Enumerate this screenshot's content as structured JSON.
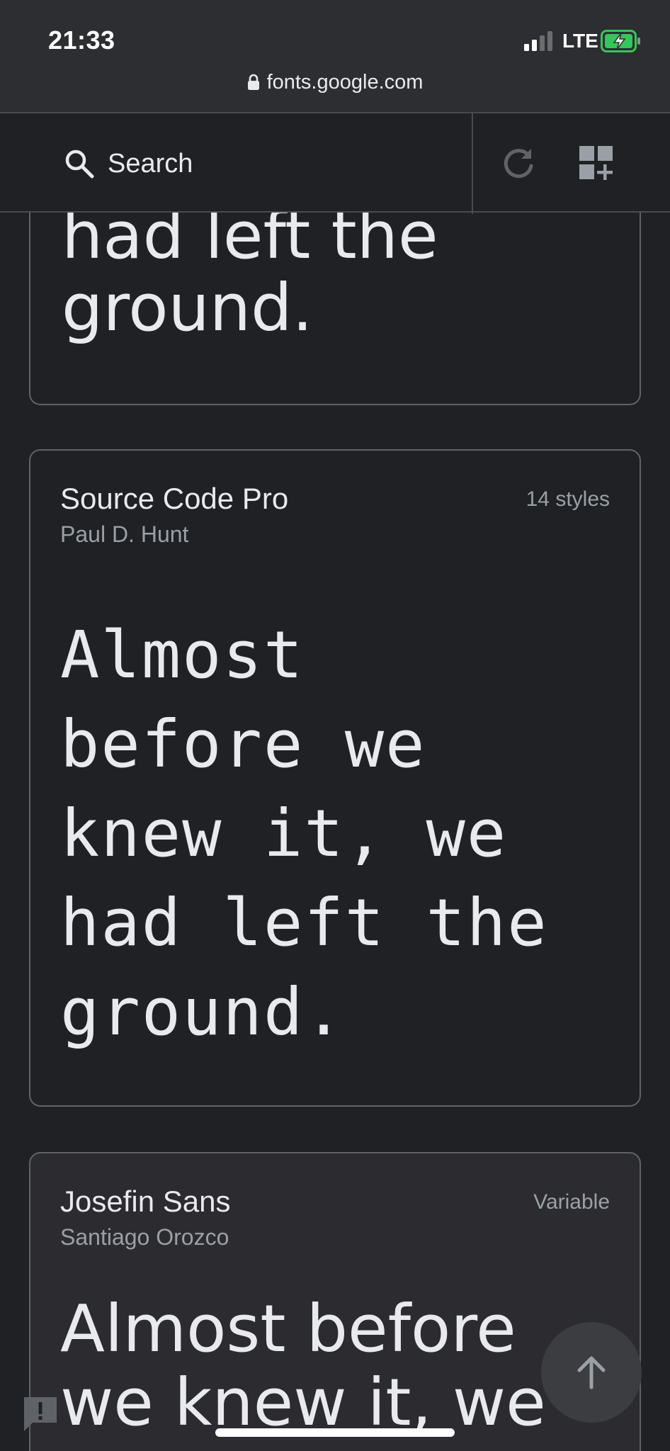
{
  "status": {
    "time": "21:33",
    "network": "LTE"
  },
  "browser": {
    "url": "fonts.google.com"
  },
  "toolbar": {
    "search_label": "Search"
  },
  "cards": [
    {
      "sample_lines": [
        "had left the",
        "ground."
      ]
    },
    {
      "name": "Source Code Pro",
      "author": "Paul D. Hunt",
      "meta": "14 styles",
      "sample": "Almost\nbefore we\nknew it, we\nhad left the\nground."
    },
    {
      "name": "Josefin Sans",
      "author": "Santiago Orozco",
      "meta": "Variable",
      "sample": "Almost before\nwe knew it, we"
    }
  ],
  "colors": {
    "background": "#202124",
    "card_border": "#5f6368",
    "text": "#e8eaed",
    "muted": "#9aa0a6",
    "battery_charge": "#34c759"
  },
  "icons": [
    "search-icon",
    "refresh-icon",
    "grid-add-icon",
    "arrow-up-icon",
    "feedback-icon",
    "lock-icon",
    "battery-icon",
    "signal-icon"
  ]
}
